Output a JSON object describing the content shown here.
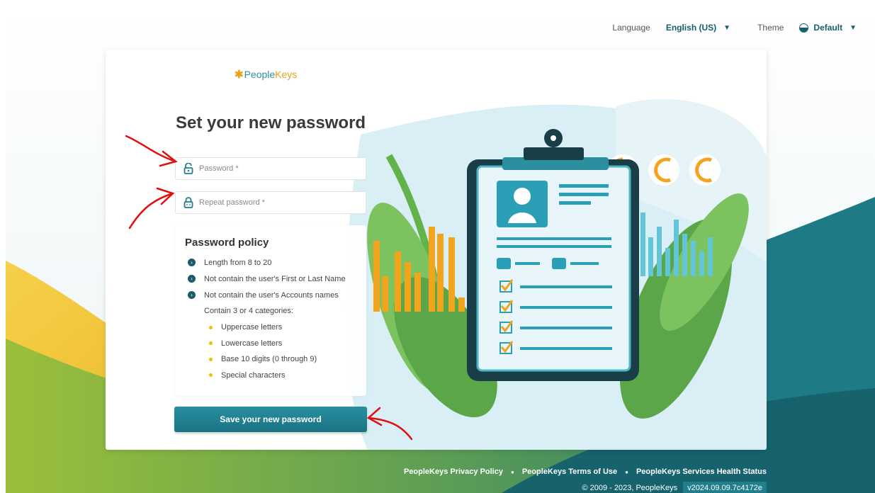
{
  "topbar": {
    "language_label": "Language",
    "language_value": "English (US)",
    "theme_label": "Theme",
    "theme_value": "Default"
  },
  "logo": {
    "people": "People",
    "keys": "Keys"
  },
  "form": {
    "title": "Set your new password",
    "password_placeholder": "Password *",
    "repeat_placeholder": "Repeat password *",
    "save_label": "Save your new password"
  },
  "policy": {
    "title": "Password policy",
    "rules": [
      "Length from 8 to 20",
      "Not contain the user's First or Last Name",
      "Not contain the user's Accounts names"
    ],
    "categories_intro": "Contain 3 or 4 categories:",
    "categories": [
      "Uppercase letters",
      "Lowercase letters",
      "Base 10 digits (0 through 9)",
      "Special characters"
    ]
  },
  "footer": {
    "privacy": "PeopleKeys Privacy Policy",
    "terms": "PeopleKeys Terms of Use",
    "health": "PeopleKeys Services Health Status",
    "copyright": "© 2009 - 2023, PeopleKeys",
    "version": "v2024.09.09.7c4172e"
  },
  "colors": {
    "accent": "#1f7f8d",
    "button": "#2590a1",
    "bullet": "#1a5a69",
    "category_dot": "#f2c000",
    "annotation_arrow": "#e01010"
  }
}
